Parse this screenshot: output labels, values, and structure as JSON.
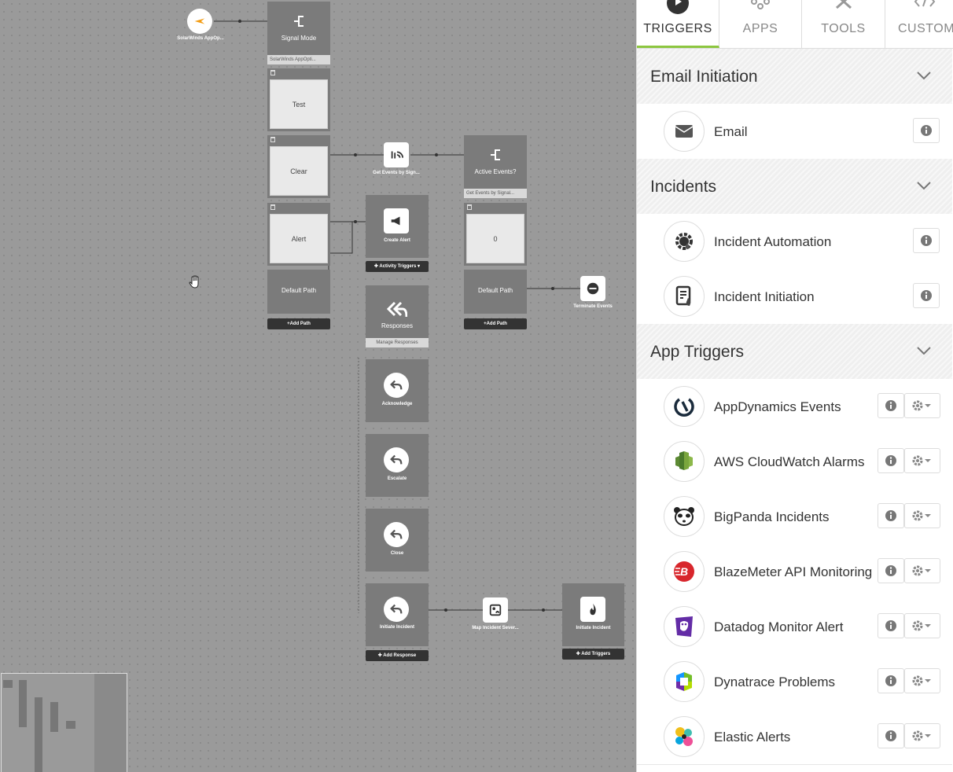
{
  "canvas": {
    "source": {
      "label": "SolarWinds AppOp..."
    },
    "signal_mode": {
      "title": "Signal Mode",
      "sub": "SolarWinds AppOpti..."
    },
    "branches": [
      "Test",
      "Clear",
      "Alert"
    ],
    "default_path": "Default Path",
    "add_path": "+Add Path",
    "get_events": "Get Events by Sign...",
    "active_events": {
      "title": "Active Events?",
      "sub": "Get Events by Signal..."
    },
    "zero_branch": "0",
    "default_path_2": "Default Path",
    "add_path_2": "+Add Path",
    "terminate": "Terminate Events",
    "create_alert": "Create Alert",
    "activity_triggers": "✚ Activity Triggers ▾",
    "responses": {
      "title": "Responses",
      "sub": "Manage Responses"
    },
    "acknowledge": "Acknowledge",
    "escalate": "Escalate",
    "close": "Close",
    "initiate_incident": "Initiate Incident",
    "add_response": "✚ Add Response",
    "map_severity": "Map Incident Sever...",
    "initiate_incident_2": "Initiate Incident",
    "add_triggers": "✚ Add Triggers"
  },
  "panel": {
    "tabs": [
      {
        "label": "TRIGGERS",
        "icon": "play-icon",
        "active": true
      },
      {
        "label": "APPS",
        "icon": "apps-icon",
        "active": false
      },
      {
        "label": "TOOLS",
        "icon": "tools-icon",
        "active": false
      },
      {
        "label": "CUSTOM",
        "icon": "code-icon",
        "active": false
      }
    ],
    "sections": [
      {
        "title": "Email Initiation",
        "items": [
          {
            "name": "Email",
            "icon": "envelope-icon"
          }
        ]
      },
      {
        "title": "Incidents",
        "items": [
          {
            "name": "Incident Automation",
            "icon": "gear-flame-icon"
          },
          {
            "name": "Incident Initiation",
            "icon": "document-flame-icon"
          }
        ]
      },
      {
        "title": "App Triggers",
        "items": [
          {
            "name": "AppDynamics Events",
            "icon": "appdynamics-icon"
          },
          {
            "name": "AWS CloudWatch Alarms",
            "icon": "aws-cloudwatch-icon"
          },
          {
            "name": "BigPanda Incidents",
            "icon": "bigpanda-icon"
          },
          {
            "name": "BlazeMeter API Monitoring",
            "icon": "blazemeter-icon"
          },
          {
            "name": "Datadog Monitor Alert",
            "icon": "datadog-icon"
          },
          {
            "name": "Dynatrace Problems",
            "icon": "dynatrace-icon"
          },
          {
            "name": "Elastic Alerts",
            "icon": "elastic-icon"
          }
        ]
      }
    ],
    "accent": "#8cc63f"
  }
}
